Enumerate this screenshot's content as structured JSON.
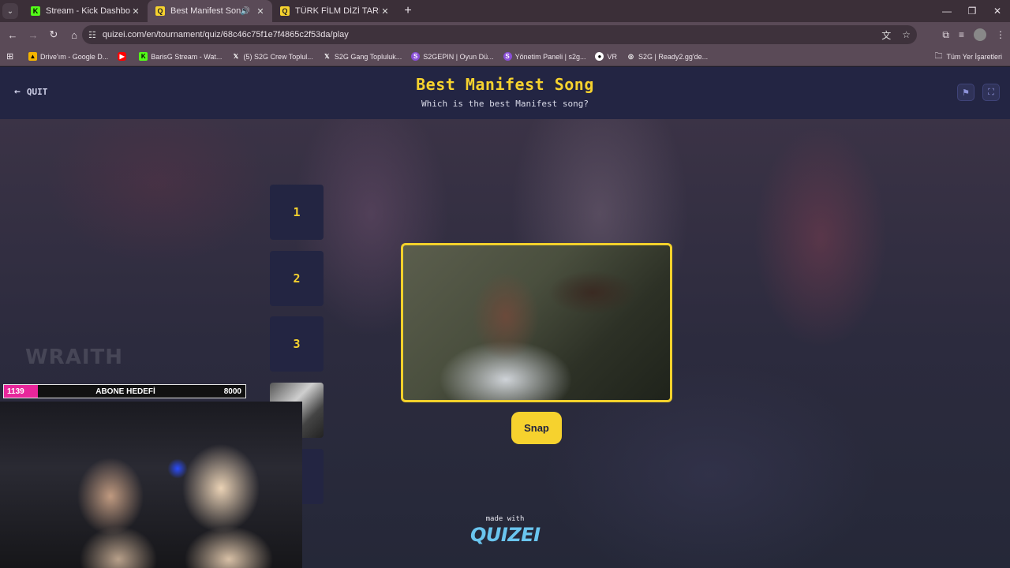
{
  "browser": {
    "tabs": [
      {
        "title": "Stream - Kick Dashboard",
        "icon": "kick-icon",
        "active": false
      },
      {
        "title": "Best Manifest Song - Tier Li",
        "icon": "quizei-icon",
        "active": true,
        "audio": true
      },
      {
        "title": "TÜRK FİLM DİZİ TARİHİNDEKİ E",
        "icon": "quizei-icon",
        "active": false
      }
    ],
    "url": "quizei.com/en/tournament/quiz/68c46c75f1e7f4865c2f53da/play",
    "bookmarks": [
      {
        "label": "Drive'ım - Google D...",
        "icon": "drive-icon",
        "color": "#f4b400"
      },
      {
        "label": "",
        "icon": "youtube-icon",
        "color": "#ff0000"
      },
      {
        "label": "BarisG Stream - Wat...",
        "icon": "kick-icon",
        "color": "#53fc18"
      },
      {
        "label": "(5) S2G Crew Toplul...",
        "icon": "x-icon",
        "color": "#ffffff"
      },
      {
        "label": "S2G Gang Topluluk...",
        "icon": "x-icon",
        "color": "#ffffff"
      },
      {
        "label": "S2GEPIN | Oyun Dü...",
        "icon": "s2g-icon",
        "color": "#8a4fd8"
      },
      {
        "label": "Yönetim Paneli | s2g...",
        "icon": "s2g-icon",
        "color": "#8a4fd8"
      },
      {
        "label": "VR",
        "icon": "vr-icon",
        "color": "#ffffff"
      },
      {
        "label": "S2G | Ready2.gg'de...",
        "icon": "globe-icon",
        "color": "#ffffff"
      }
    ],
    "all_bookmarks": "Tüm Yer İşaretleri"
  },
  "app": {
    "quit_label": "QUIT",
    "title": "Best Manifest Song",
    "subtitle": "Which is the best Manifest song?",
    "accent": "#f6d22e",
    "slots": [
      "1",
      "2",
      "3"
    ],
    "snap_label": "Snap",
    "made_with": "made with",
    "logo": "QUIZEI"
  },
  "stream": {
    "goal_label": "ABONE HEDEFİ",
    "goal_current": "1139",
    "goal_max": "8000",
    "goal_progress": 0.142,
    "watermark": "WRAITH"
  }
}
